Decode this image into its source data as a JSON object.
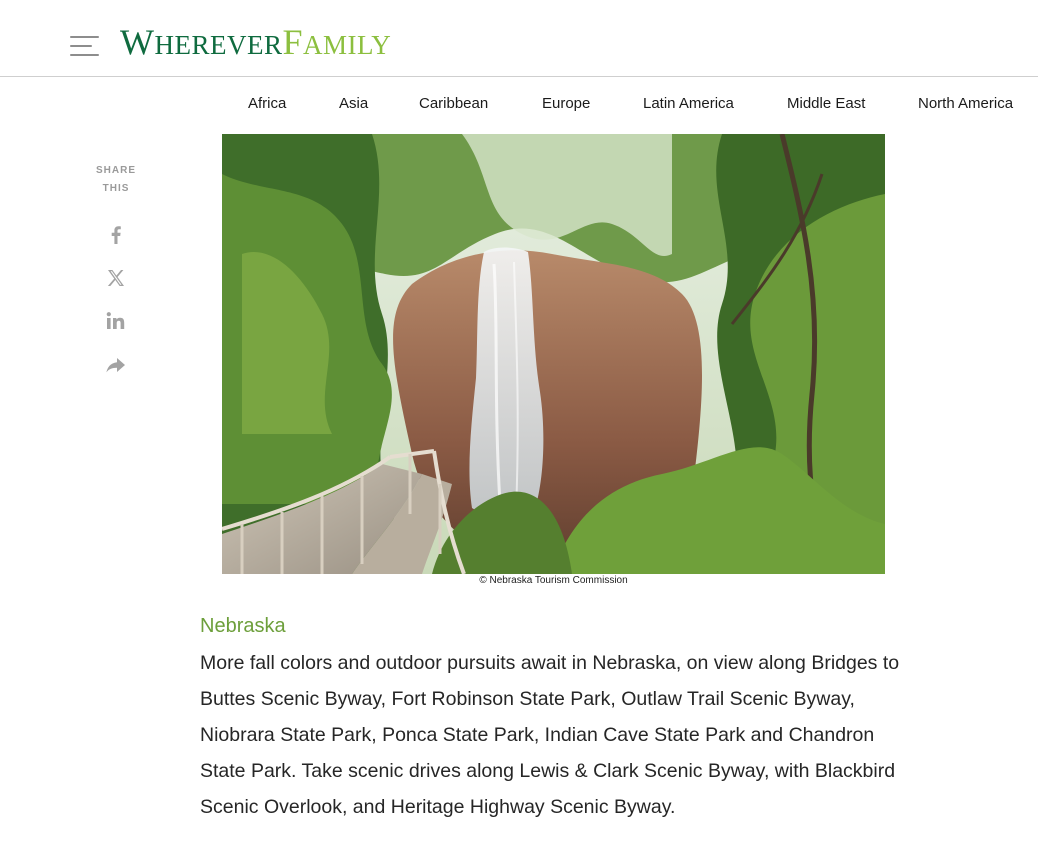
{
  "header": {
    "logo": {
      "first_initial": "W",
      "first_rest": "HEREVER",
      "second_initial": "F",
      "second_rest": "AMILY"
    },
    "menu_icon": "hamburger-menu-icon"
  },
  "regions": [
    "Africa",
    "Asia",
    "Caribbean",
    "Europe",
    "Latin America",
    "Middle East",
    "North America"
  ],
  "share": {
    "label_line1": "SHARE",
    "label_line2": "THIS",
    "icons": [
      "facebook-icon",
      "x-icon",
      "linkedin-icon",
      "share-arrow-icon"
    ]
  },
  "photo": {
    "subject": "waterfall-with-wooden-boardwalk",
    "credit": "© Nebraska Tourism Commission"
  },
  "article": {
    "heading": "Nebraska",
    "body": "More fall colors and outdoor pursuits await in Nebraska, on view along Bridges to Buttes Scenic Byway, Fort Robinson State Park, Outlaw Trail Scenic Byway, Niobrara State Park, Ponca State Park, Indian Cave State Park and Chandron State Park. Take scenic drives along Lewis & Clark Scenic Byway, with Blackbird Scenic Overlook, and Heritage Highway Scenic Byway."
  },
  "colors": {
    "brand_dark": "#0f6b3f",
    "brand_light": "#8cbf3f",
    "heading_green": "#6d9f3b",
    "icon_gray": "#a3a3a3"
  }
}
